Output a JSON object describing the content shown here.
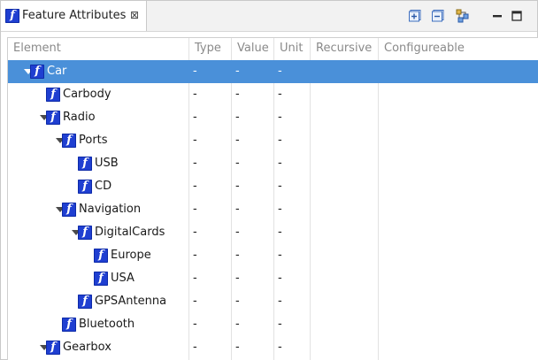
{
  "tab": {
    "title": "Feature Attributes",
    "close_glyph": "⊠",
    "icon": "feature-icon"
  },
  "toolbar": [
    {
      "name": "expand-all-icon"
    },
    {
      "name": "collapse-all-icon"
    },
    {
      "name": "link-editor-icon"
    },
    {
      "name": "minimize-icon"
    },
    {
      "name": "maximize-icon"
    }
  ],
  "columns": [
    "Element",
    "Type",
    "Value",
    "Unit",
    "Recursive",
    "Configureable"
  ],
  "rows": [
    {
      "label": "Car",
      "level": 0,
      "expander": true,
      "selected": true,
      "type": "-",
      "value": "-",
      "unit": "-"
    },
    {
      "label": "Carbody",
      "level": 1,
      "expander": false,
      "selected": false,
      "type": "-",
      "value": "-",
      "unit": "-"
    },
    {
      "label": "Radio",
      "level": 1,
      "expander": true,
      "selected": false,
      "type": "-",
      "value": "-",
      "unit": "-"
    },
    {
      "label": "Ports",
      "level": 2,
      "expander": true,
      "selected": false,
      "type": "-",
      "value": "-",
      "unit": "-"
    },
    {
      "label": "USB",
      "level": 3,
      "expander": false,
      "selected": false,
      "type": "-",
      "value": "-",
      "unit": "-"
    },
    {
      "label": "CD",
      "level": 3,
      "expander": false,
      "selected": false,
      "type": "-",
      "value": "-",
      "unit": "-"
    },
    {
      "label": "Navigation",
      "level": 2,
      "expander": true,
      "selected": false,
      "type": "-",
      "value": "-",
      "unit": "-"
    },
    {
      "label": "DigitalCards",
      "level": 3,
      "expander": true,
      "selected": false,
      "type": "-",
      "value": "-",
      "unit": "-"
    },
    {
      "label": "Europe",
      "level": 4,
      "expander": false,
      "selected": false,
      "type": "-",
      "value": "-",
      "unit": "-"
    },
    {
      "label": "USA",
      "level": 4,
      "expander": false,
      "selected": false,
      "type": "-",
      "value": "-",
      "unit": "-"
    },
    {
      "label": "GPSAntenna",
      "level": 3,
      "expander": false,
      "selected": false,
      "type": "-",
      "value": "-",
      "unit": "-"
    },
    {
      "label": "Bluetooth",
      "level": 2,
      "expander": false,
      "selected": false,
      "type": "-",
      "value": "-",
      "unit": "-"
    },
    {
      "label": "Gearbox",
      "level": 1,
      "expander": true,
      "selected": false,
      "type": "-",
      "value": "-",
      "unit": "-"
    }
  ],
  "icon_glyph": "f",
  "colors": {
    "selection": "#4a90d9",
    "feature_icon": "#1f3fd1"
  }
}
